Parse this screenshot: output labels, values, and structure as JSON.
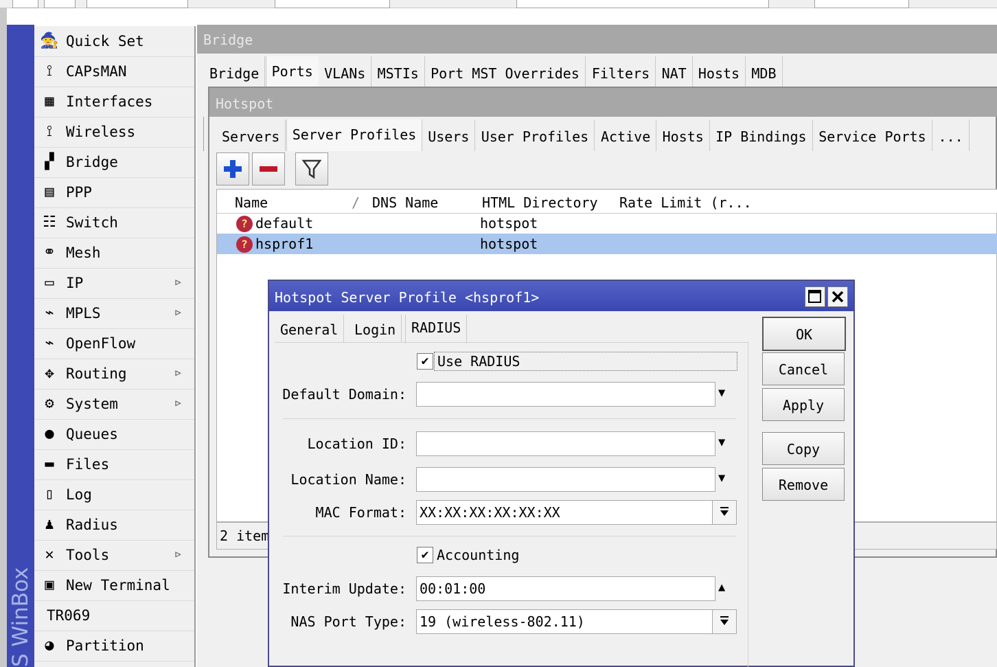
{
  "sidebar": {
    "brand": "S WinBox",
    "items": [
      {
        "label": "Quick Set",
        "icon": "quick-set-icon",
        "glyph": "🧙",
        "arrow": false
      },
      {
        "label": "CAPsMAN",
        "icon": "antenna-icon",
        "glyph": "⟟",
        "arrow": false
      },
      {
        "label": "Interfaces",
        "icon": "interfaces-icon",
        "glyph": "▦",
        "arrow": false
      },
      {
        "label": "Wireless",
        "icon": "wireless-icon",
        "glyph": "⟟",
        "arrow": false
      },
      {
        "label": "Bridge",
        "icon": "bridge-icon",
        "glyph": "▞",
        "arrow": false
      },
      {
        "label": "PPP",
        "icon": "ppp-icon",
        "glyph": "▤",
        "arrow": false
      },
      {
        "label": "Switch",
        "icon": "switch-icon",
        "glyph": "☷",
        "arrow": false
      },
      {
        "label": "Mesh",
        "icon": "mesh-icon",
        "glyph": "⚭",
        "arrow": false
      },
      {
        "label": "IP",
        "icon": "ip-icon",
        "glyph": "▭",
        "arrow": true
      },
      {
        "label": "MPLS",
        "icon": "mpls-icon",
        "glyph": "⌁",
        "arrow": true
      },
      {
        "label": "OpenFlow",
        "icon": "openflow-icon",
        "glyph": "⌁",
        "arrow": false
      },
      {
        "label": "Routing",
        "icon": "routing-icon",
        "glyph": "✥",
        "arrow": true
      },
      {
        "label": "System",
        "icon": "system-gear-icon",
        "glyph": "⚙",
        "arrow": true
      },
      {
        "label": "Queues",
        "icon": "queues-icon",
        "glyph": "●",
        "arrow": false
      },
      {
        "label": "Files",
        "icon": "files-icon",
        "glyph": "▬",
        "arrow": false
      },
      {
        "label": "Log",
        "icon": "log-icon",
        "glyph": "▯",
        "arrow": false
      },
      {
        "label": "Radius",
        "icon": "radius-users-icon",
        "glyph": "♟",
        "arrow": false
      },
      {
        "label": "Tools",
        "icon": "tools-icon",
        "glyph": "✕",
        "arrow": true
      },
      {
        "label": "New Terminal",
        "icon": "terminal-icon",
        "glyph": "▣",
        "arrow": false
      },
      {
        "label": "TR069",
        "icon": "",
        "glyph": "",
        "arrow": false
      },
      {
        "label": "Partition",
        "icon": "partition-pie-icon",
        "glyph": "◕",
        "arrow": false
      }
    ]
  },
  "bridge_window": {
    "title": "Bridge",
    "tabs": [
      "Bridge",
      "Ports",
      "VLANs",
      "MSTIs",
      "Port MST Overrides",
      "Filters",
      "NAT",
      "Hosts",
      "MDB"
    ]
  },
  "hotspot_window": {
    "title": "Hotspot",
    "tabs": [
      "Servers",
      "Server Profiles",
      "Users",
      "User Profiles",
      "Active",
      "Hosts",
      "IP Bindings",
      "Service Ports",
      "..."
    ],
    "columns": [
      "Name",
      "DNS Name",
      "HTML Directory",
      "Rate Limit (r..."
    ],
    "sort_glyph": "/",
    "rows": [
      {
        "name": "default",
        "dns_name": "",
        "html_directory": "hotspot",
        "rate_limit": ""
      },
      {
        "name": "hsprof1",
        "dns_name": "",
        "html_directory": "hotspot",
        "rate_limit": ""
      }
    ],
    "status": "2 item"
  },
  "dialog": {
    "title": "Hotspot Server Profile <hsprof1>",
    "tabs": [
      "General",
      "Login",
      "RADIUS"
    ],
    "use_radius_label": "Use RADIUS",
    "default_domain_label": "Default Domain:",
    "default_domain_value": "",
    "location_id_label": "Location ID:",
    "location_id_value": "",
    "location_name_label": "Location Name:",
    "location_name_value": "",
    "mac_format_label": "MAC Format:",
    "mac_format_value": "XX:XX:XX:XX:XX:XX",
    "accounting_label": "Accounting",
    "interim_update_label": "Interim Update:",
    "interim_update_value": "00:01:00",
    "nas_port_type_label": "NAS Port Type:",
    "nas_port_type_value": "19 (wireless-802.11)",
    "buttons": {
      "ok": "OK",
      "cancel": "Cancel",
      "apply": "Apply",
      "copy": "Copy",
      "remove": "Remove"
    }
  },
  "colors": {
    "accent": "#3d49b4",
    "selection": "#a9c6ee",
    "title_bar": "#a7a7a7"
  }
}
